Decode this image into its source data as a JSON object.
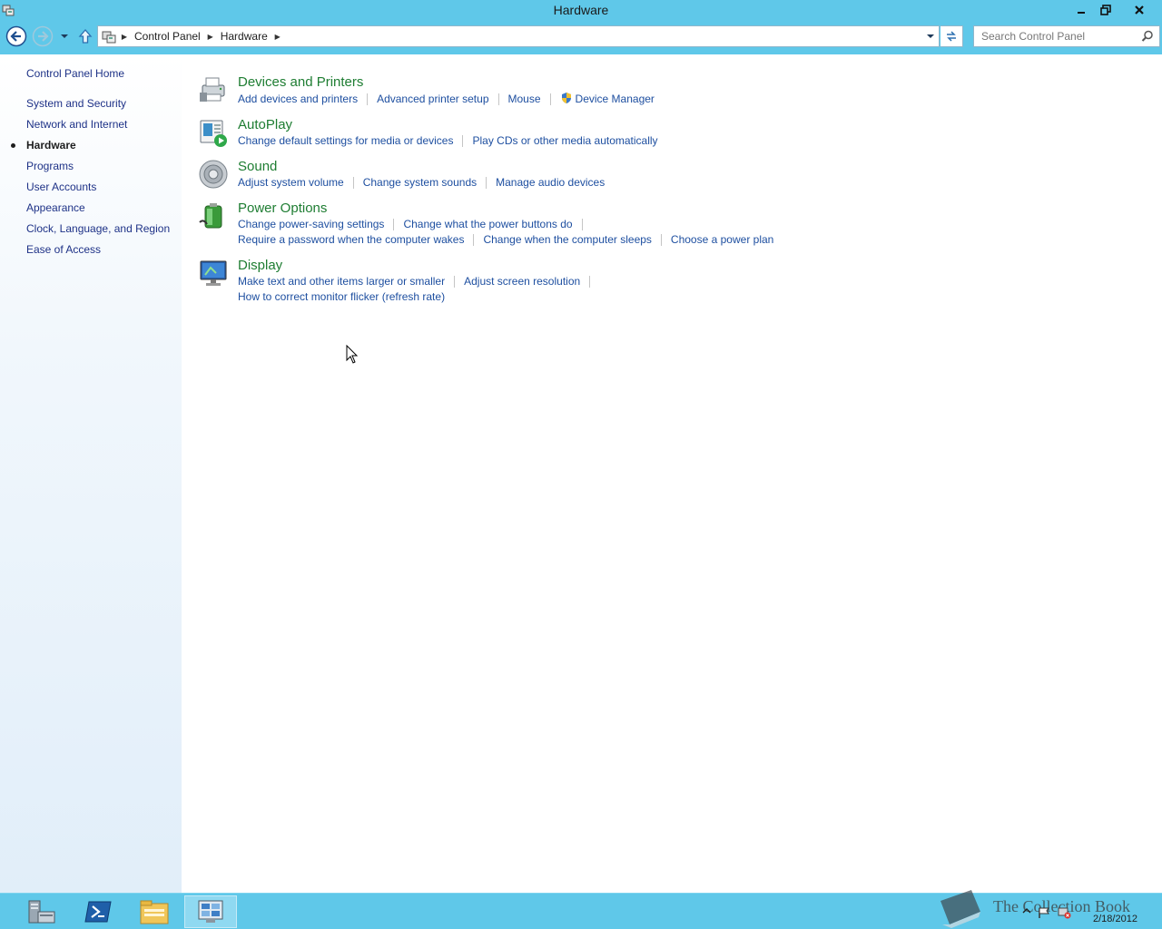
{
  "window": {
    "title": "Hardware"
  },
  "address": {
    "crumbs": [
      "Control Panel",
      "Hardware"
    ]
  },
  "search": {
    "placeholder": "Search Control Panel"
  },
  "sidebar": {
    "items": [
      {
        "label": "Control Panel Home"
      },
      {
        "label": "System and Security"
      },
      {
        "label": "Network and Internet"
      },
      {
        "label": "Hardware",
        "current": true
      },
      {
        "label": "Programs"
      },
      {
        "label": "User Accounts"
      },
      {
        "label": "Appearance"
      },
      {
        "label": "Clock, Language, and Region"
      },
      {
        "label": "Ease of Access"
      }
    ]
  },
  "categories": [
    {
      "title": "Devices and Printers",
      "icon": "printer-icon",
      "links": [
        "Add devices and printers",
        "Advanced printer setup",
        "Mouse",
        "Device Manager"
      ]
    },
    {
      "title": "AutoPlay",
      "icon": "autoplay-icon",
      "links": [
        "Change default settings for media or devices",
        "Play CDs or other media automatically"
      ]
    },
    {
      "title": "Sound",
      "icon": "speaker-icon",
      "links": [
        "Adjust system volume",
        "Change system sounds",
        "Manage audio devices"
      ]
    },
    {
      "title": "Power Options",
      "icon": "battery-icon",
      "links": [
        "Change power-saving settings",
        "Change what the power buttons do",
        "Require a password when the computer wakes",
        "Change when the computer sleeps",
        "Choose a power plan"
      ]
    },
    {
      "title": "Display",
      "icon": "monitor-icon",
      "links": [
        "Make text and other items larger or smaller",
        "Adjust screen resolution",
        "How to correct monitor flicker (refresh rate)"
      ]
    }
  ],
  "taskbar": {
    "items": [
      "server-manager-icon",
      "powershell-icon",
      "file-explorer-icon",
      "control-panel-icon"
    ],
    "watermark": "The Collection Book",
    "date": "2/18/2012"
  },
  "colors": {
    "chrome": "#5fc8e9",
    "category_title": "#1e7d32",
    "link": "#1e4fa0",
    "sidebar_link": "#1e3287"
  }
}
